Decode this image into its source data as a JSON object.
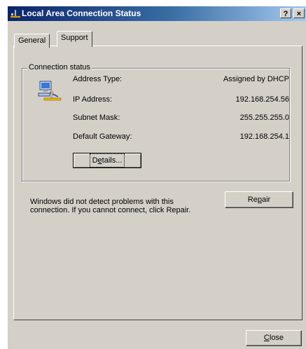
{
  "window": {
    "title": "Local Area Connection Status",
    "help_label": "?",
    "close_glyph": "×"
  },
  "tabs": [
    {
      "label": "General",
      "selected": false
    },
    {
      "label": "Support",
      "selected": true
    }
  ],
  "connection_status": {
    "group_label": "Connection status",
    "icon": "network-connection-icon",
    "rows": [
      {
        "label": "Address Type:",
        "value": "Assigned by DHCP"
      },
      {
        "label": "IP Address:",
        "value": "192.168.254.56"
      },
      {
        "label": "Subnet Mask:",
        "value": "255.255.255.0"
      },
      {
        "label": "Default Gateway:",
        "value": "192.168.254.1"
      }
    ],
    "details_button": {
      "label_prefix": "D",
      "label_underlined": "e",
      "label_suffix": "tails..."
    }
  },
  "message": "Windows did not detect problems with this connection. If you cannot connect, click Repair.",
  "repair_button": {
    "label_prefix": "Re",
    "label_underlined": "p",
    "label_suffix": "air"
  },
  "close_button": {
    "label_prefix": "",
    "label_underlined": "C",
    "label_suffix": "lose"
  },
  "colors": {
    "face": "#d4d0c8",
    "titlebar_start": "#0a246a",
    "titlebar_end": "#a6caf0"
  }
}
